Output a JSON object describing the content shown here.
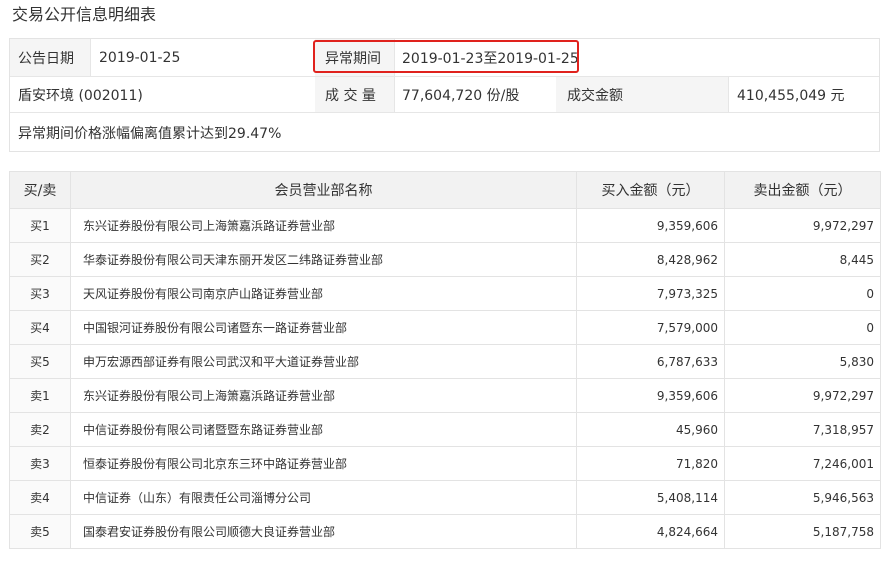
{
  "title": "交易公开信息明细表",
  "info": {
    "announce_date_label": "公告日期",
    "announce_date": "2019-01-25",
    "abnormal_period_label": "异常期间",
    "abnormal_period": "2019-01-23至2019-01-25",
    "stock": "盾安环境 (002011)",
    "volume_label": "成 交 量",
    "volume": "77,604,720 份/股",
    "amount_label": "成交金额",
    "amount": "410,455,049 元",
    "note": "异常期间价格涨幅偏离值累计达到29.47%"
  },
  "table": {
    "headers": [
      "买/卖",
      "会员营业部名称",
      "买入金额（元）",
      "卖出金额（元）"
    ],
    "rows": [
      {
        "side": "买1",
        "name": "东兴证券股份有限公司上海箫嘉浜路证券营业部",
        "buy": "9,359,606",
        "sell": "9,972,297"
      },
      {
        "side": "买2",
        "name": "华泰证券股份有限公司天津东丽开发区二纬路证券营业部",
        "buy": "8,428,962",
        "sell": "8,445"
      },
      {
        "side": "买3",
        "name": "天风证券股份有限公司南京庐山路证券营业部",
        "buy": "7,973,325",
        "sell": "0"
      },
      {
        "side": "买4",
        "name": "中国银河证券股份有限公司诸暨东一路证券营业部",
        "buy": "7,579,000",
        "sell": "0"
      },
      {
        "side": "买5",
        "name": "申万宏源西部证券有限公司武汉和平大道证券营业部",
        "buy": "6,787,633",
        "sell": "5,830"
      },
      {
        "side": "卖1",
        "name": "东兴证券股份有限公司上海箫嘉浜路证券营业部",
        "buy": "9,359,606",
        "sell": "9,972,297"
      },
      {
        "side": "卖2",
        "name": "中信证券股份有限公司诸暨暨东路证券营业部",
        "buy": "45,960",
        "sell": "7,318,957"
      },
      {
        "side": "卖3",
        "name": "恒泰证券股份有限公司北京东三环中路证券营业部",
        "buy": "71,820",
        "sell": "7,246,001"
      },
      {
        "side": "卖4",
        "name": "中信证券（山东）有限责任公司淄博分公司",
        "buy": "5,408,114",
        "sell": "5,946,563"
      },
      {
        "side": "卖5",
        "name": "国泰君安证券股份有限公司顺德大良证券营业部",
        "buy": "4,824,664",
        "sell": "5,187,758"
      }
    ]
  },
  "colors": {
    "highlight": "#e0221d",
    "header_bg": "#f2f2f2",
    "border": "#e3e3e3"
  }
}
